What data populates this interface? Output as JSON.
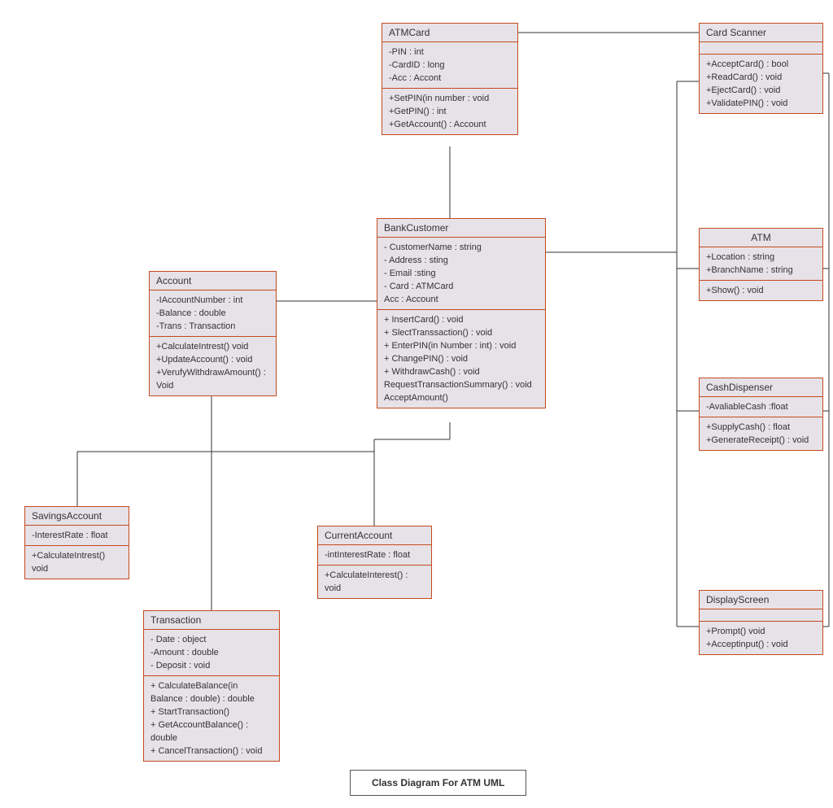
{
  "title": "Class Diagram For ATM UML",
  "classes": {
    "atmcard": {
      "name": "ATMCard",
      "attrs": [
        "-PIN : int",
        "-CardID : long",
        "-Acc : Accont"
      ],
      "ops": [
        "+SetPIN(in number : void",
        "+GetPIN() : int",
        "+GetAccount() : Account"
      ]
    },
    "cardscanner": {
      "name": "Card Scanner",
      "attrs": [],
      "ops": [
        "+AcceptCard() : bool",
        "+ReadCard() : void",
        "+EjectCard() : void",
        "+ValidatePIN() : void"
      ]
    },
    "account": {
      "name": "Account",
      "attrs": [
        "-IAccountNumber : int",
        "-Balance : double",
        "-Trans  : Transaction"
      ],
      "ops": [
        "+CalculateIntrest() void",
        "+UpdateAccount() : void",
        "+VerufyWithdrawAmount() : Void"
      ]
    },
    "bankcustomer": {
      "name": "BankCustomer",
      "attrs": [
        "- CustomerName : string",
        "- Address : sting",
        "- Email :sting",
        "- Card : ATMCard",
        "Acc : Account"
      ],
      "ops": [
        "+ InsertCard() : void",
        "+ SlectTranssaction()  : void",
        "+ EnterPIN(in Number : int) : void",
        "+ ChangePIN() : void",
        "+ WithdrawCash() : void",
        "RequestTransactionSummary()  : void",
        "AcceptAmount()"
      ]
    },
    "atm": {
      "name": "ATM",
      "attrs": [
        "+Location : string",
        "+BranchName : string"
      ],
      "ops": [
        "+Show() : void"
      ]
    },
    "cashdispenser": {
      "name": "CashDispenser",
      "attrs": [
        "-AvaliableCash :float"
      ],
      "ops": [
        "+SupplyCash() : float",
        "+GenerateReceipt() : void"
      ]
    },
    "savingsaccount": {
      "name": "SavingsAccount",
      "attrs": [
        "-InterestRate : float"
      ],
      "ops": [
        "+CalculateIntrest() void"
      ]
    },
    "currentaccount": {
      "name": "CurrentAccount",
      "attrs": [
        "-intInterestRate : float"
      ],
      "ops": [
        "+CalculateInterest() : void"
      ]
    },
    "displayscreen": {
      "name": "DisplayScreen",
      "attrs": [],
      "ops": [
        "+Prompt() void",
        "+Acceptinput() : void"
      ]
    },
    "transaction": {
      "name": "Transaction",
      "attrs": [
        "- Date : object",
        "-Amount : double",
        "- Deposit : void"
      ],
      "ops": [
        "+ CalculateBalance(in Balance : double) : double",
        "+ StartTransaction()",
        "+ GetAccountBalance() : double",
        "+ CancelTransaction() : void"
      ]
    }
  }
}
